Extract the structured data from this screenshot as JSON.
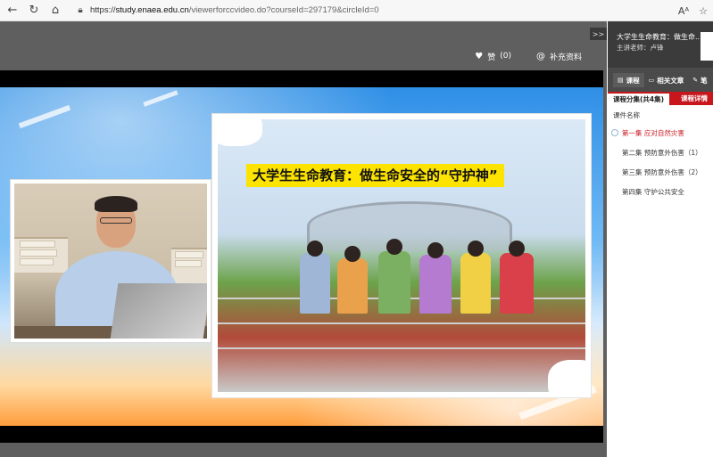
{
  "browser": {
    "url_prefix": "https://",
    "url_host": "study.enaea.edu.cn",
    "url_rest": "/viewerforccvideo.do?courseId=297179&circleId=0"
  },
  "actions": {
    "like_label": "赞",
    "like_count": "(0)",
    "supplement_label": "补充资料"
  },
  "player": {
    "slide_title": "大学生生命教育：做生命安全的“守护神”"
  },
  "sidebar": {
    "collapse_label": ">>",
    "course_title": "大学生生命教育：做生命...",
    "teacher_line": "主讲老师：卢锋",
    "tabs": [
      {
        "label": "课程"
      },
      {
        "label": "相关文章"
      },
      {
        "label": "笔"
      }
    ],
    "subtabs": {
      "episodes": "课程分集(共4集)",
      "details": "课程详情"
    },
    "column_header": "课件名称",
    "episodes": [
      {
        "label": "第一集 应对自然灾害",
        "current": true
      },
      {
        "label": "第二集 预防意外伤害（1）",
        "current": false
      },
      {
        "label": "第三集 预防意外伤害（2）",
        "current": false
      },
      {
        "label": "第四集 守护公共安全",
        "current": false
      }
    ]
  }
}
